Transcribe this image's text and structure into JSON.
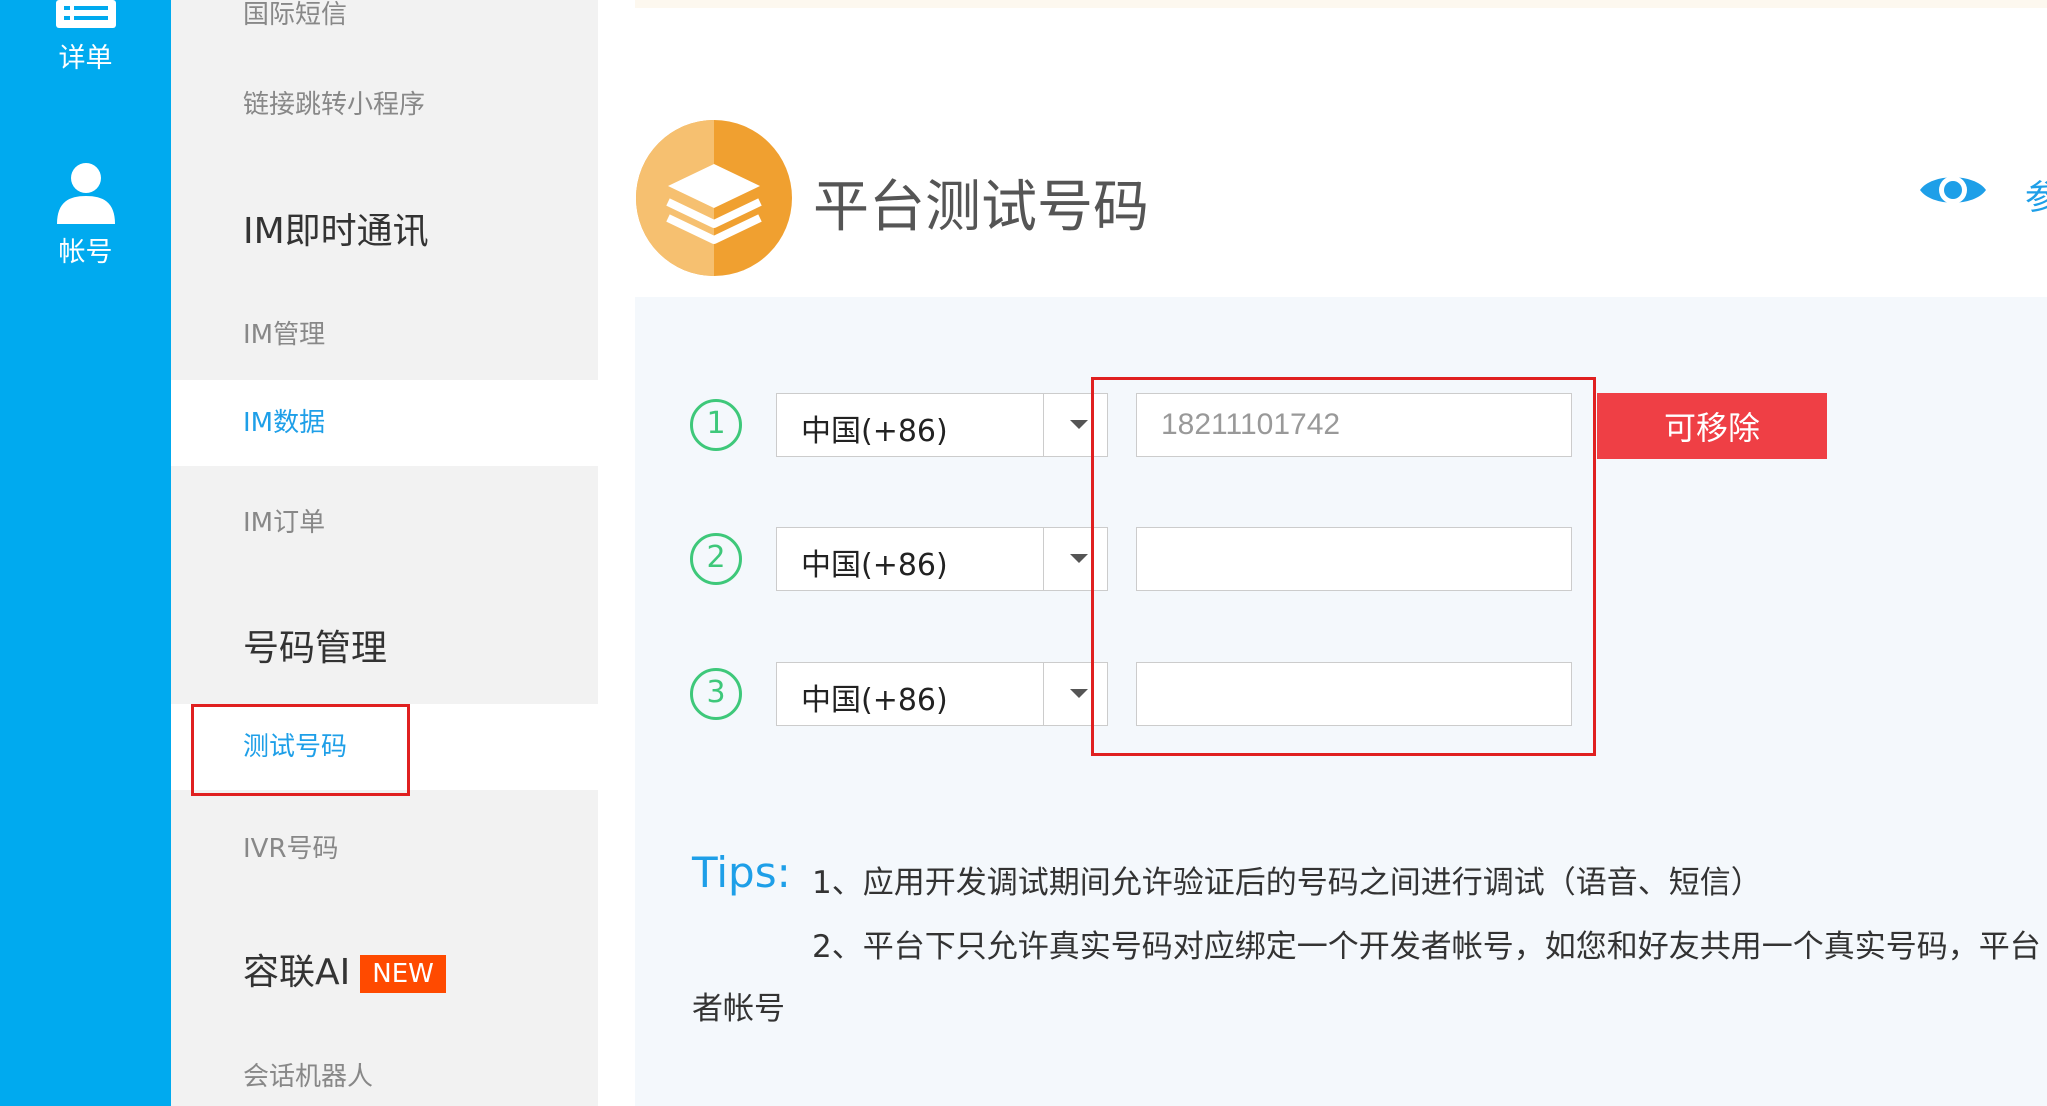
{
  "rail": {
    "items": [
      {
        "label": "详单"
      },
      {
        "label": "帐号"
      }
    ]
  },
  "sidebar": {
    "items": [
      {
        "label": "国际短信"
      },
      {
        "label": "链接跳转小程序"
      },
      {
        "group": "IM即时通讯"
      },
      {
        "label": "IM管理"
      },
      {
        "label": "IM数据"
      },
      {
        "label": "IM订单"
      },
      {
        "group": "号码管理"
      },
      {
        "label": "测试号码"
      },
      {
        "label": "IVR号码"
      },
      {
        "group": "容联AI",
        "badge": "NEW"
      },
      {
        "label": "会话机器人"
      }
    ]
  },
  "header": {
    "title": "平台测试号码",
    "cut_text": "参"
  },
  "rows": [
    {
      "num": "1",
      "country": "中国(+86)",
      "phone": "18211101742"
    },
    {
      "num": "2",
      "country": "中国(+86)",
      "phone": ""
    },
    {
      "num": "3",
      "country": "中国(+86)",
      "phone": ""
    }
  ],
  "remove_button": "可移除",
  "tips": {
    "label": "Tips:",
    "line1": "1、应用开发调试期间允许验证后的号码之间进行调试（语音、短信）",
    "line2": "2、平台下只允许真实号码对应绑定一个开发者帐号，如您和好友共用一个真实号码，平台",
    "line3": "者帐号"
  },
  "colors": {
    "rail": "#00aaef",
    "accent": "#1e9fe8",
    "danger": "#ef3f45",
    "badge": "#ff4a00",
    "step": "#3ec87a",
    "logo": "#f0a030"
  },
  "icons": [
    "list-icon",
    "user-icon",
    "layers-icon",
    "eye-icon",
    "chevron-down-icon"
  ]
}
